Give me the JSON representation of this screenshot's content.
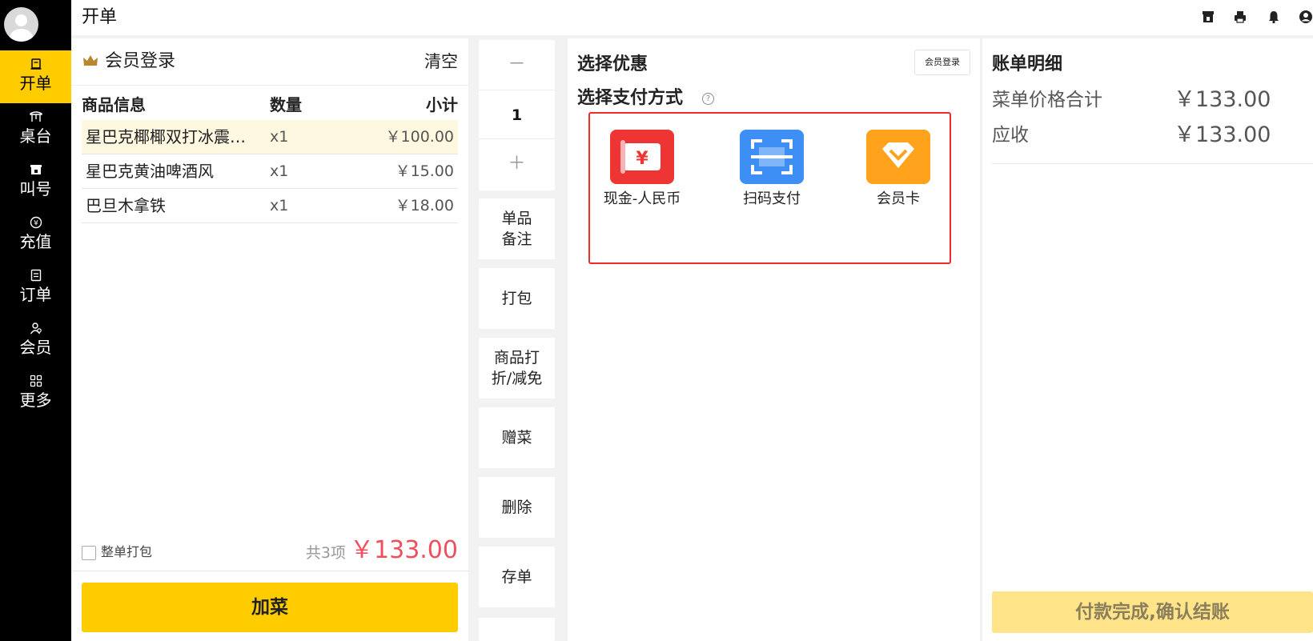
{
  "topbar": {
    "title": "开单"
  },
  "sidebar": {
    "items": [
      {
        "label": "开单",
        "icon": "order-icon"
      },
      {
        "label": "桌台",
        "icon": "table-icon"
      },
      {
        "label": "叫号",
        "icon": "call-number-icon"
      },
      {
        "label": "充值",
        "icon": "recharge-icon"
      },
      {
        "label": "订单",
        "icon": "orders-icon"
      },
      {
        "label": "会员",
        "icon": "member-icon"
      },
      {
        "label": "更多",
        "icon": "more-icon"
      }
    ],
    "active_index": 0
  },
  "order": {
    "member_login": "会员登录",
    "clear": "清空",
    "headers": {
      "info": "商品信息",
      "qty": "数量",
      "subtotal": "小计"
    },
    "items": [
      {
        "name": "星巴克椰椰双打冰震…",
        "qty": "x1",
        "amount": "￥100.00"
      },
      {
        "name": "星巴克黄油啤酒风",
        "qty": "x1",
        "amount": "￥15.00"
      },
      {
        "name": "巴旦木拿铁",
        "qty": "x1",
        "amount": "￥18.00"
      }
    ],
    "pack_all": "整单打包",
    "count": "共3项",
    "total": "￥133.00",
    "add_button": "加菜"
  },
  "actions": {
    "minus": "－",
    "quantity": "1",
    "plus": "＋",
    "item_note": [
      "单品",
      "备注"
    ],
    "pack": "打包",
    "discount": [
      "商品打",
      "折/减免"
    ],
    "gift": "赠菜",
    "delete": "删除",
    "save": "存单"
  },
  "payment": {
    "discount_title": "选择优惠",
    "member_login_btn": "会员登录",
    "method_title": "选择支付方式",
    "help": "?",
    "methods": [
      {
        "label": "现金-人民币",
        "icon": "cash-icon",
        "color": "#ef3434"
      },
      {
        "label": "扫码支付",
        "icon": "scan-icon",
        "color": "#3d8ff5"
      },
      {
        "label": "会员卡",
        "icon": "member-card-icon",
        "color": "#ffa21c"
      }
    ]
  },
  "bill": {
    "title": "账单明细",
    "menu_total_label": "菜单价格合计",
    "menu_total": "￥133.00",
    "receivable_label": "应收",
    "receivable": "￥133.00",
    "confirm": "付款完成,确认结账"
  },
  "colors": {
    "accent": "#ffcc00",
    "price": "#f04f5d",
    "highlight": "#ef2b2b"
  }
}
